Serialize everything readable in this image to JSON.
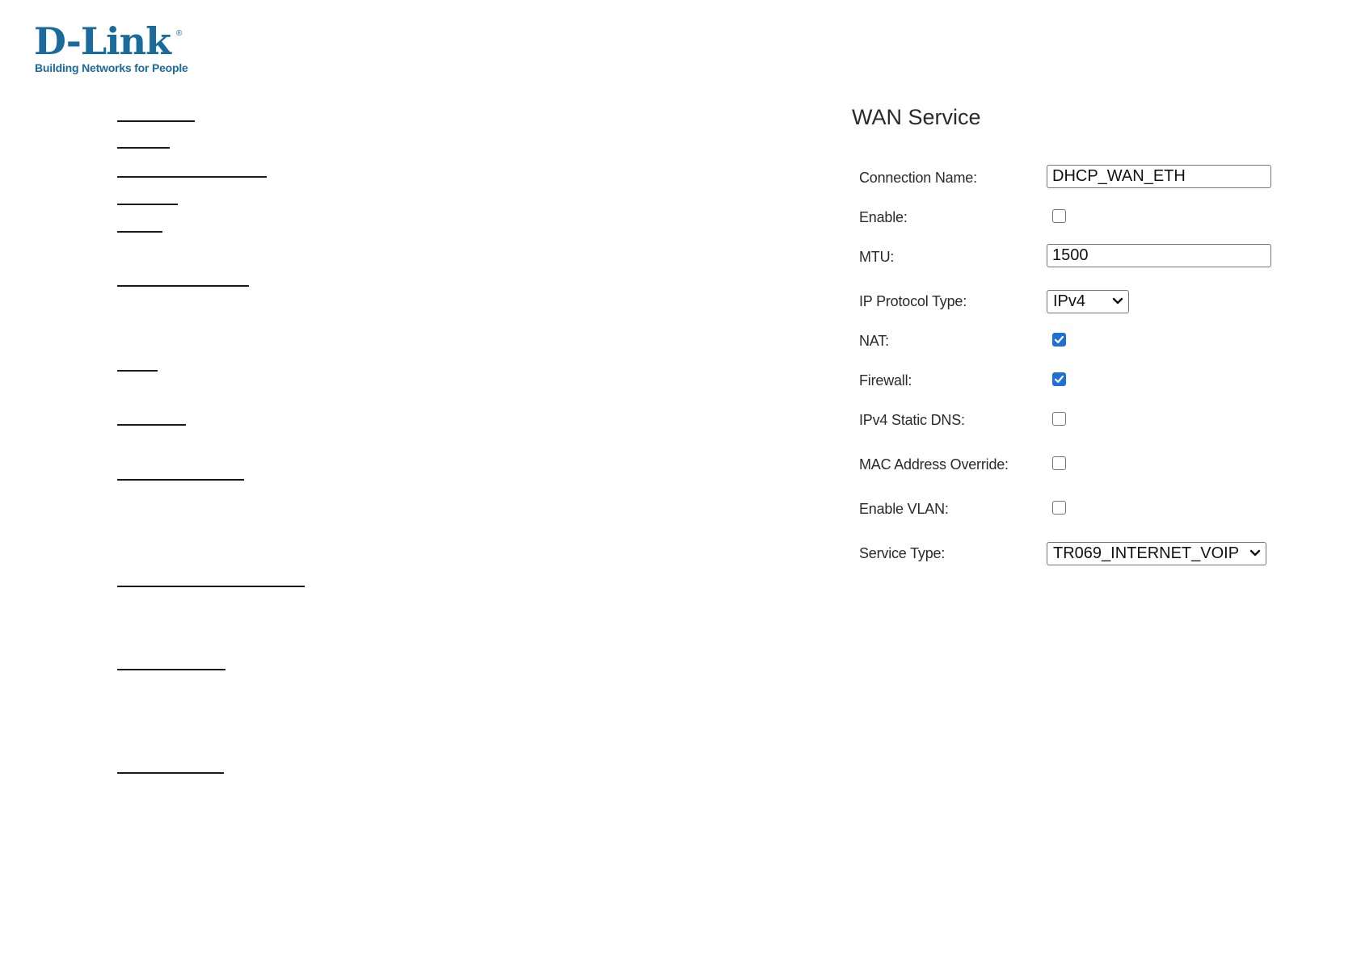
{
  "logo": {
    "word": "D-Link",
    "registered": "®",
    "tagline": "Building Networks for People"
  },
  "nav": {
    "link_count": 13
  },
  "wan_service": {
    "title": "WAN Service",
    "fields": {
      "connection_name": {
        "label": "Connection Name:",
        "value": "DHCP_WAN_ETH"
      },
      "enable": {
        "label": "Enable:",
        "checked": false
      },
      "mtu": {
        "label": "MTU:",
        "value": "1500"
      },
      "ip_protocol_type": {
        "label": "IP Protocol Type:",
        "selected": "IPv4"
      },
      "nat": {
        "label": "NAT:",
        "checked": true
      },
      "firewall": {
        "label": "Firewall:",
        "checked": true
      },
      "ipv4_static_dns": {
        "label": "IPv4 Static DNS:",
        "checked": false
      },
      "mac_address_override": {
        "label": "MAC Address Override:",
        "checked": false
      },
      "enable_vlan": {
        "label": "Enable VLAN:",
        "checked": false
      },
      "service_type": {
        "label": "Service Type:",
        "selected": "TR069_INTERNET_VOIP"
      }
    }
  },
  "colors": {
    "brand": "#1b6a9c",
    "checkbox_checked": "#1f6fd6"
  }
}
